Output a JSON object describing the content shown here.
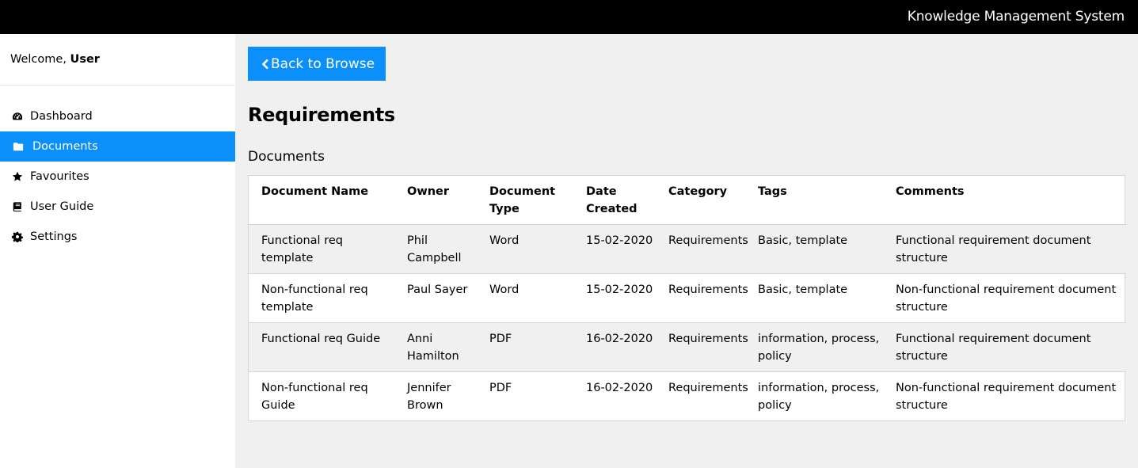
{
  "app": {
    "title": "Knowledge Management System"
  },
  "sidebar": {
    "welcome_prefix": "Welcome,",
    "user_name": "User",
    "items": [
      {
        "label": "Dashboard",
        "icon": "dashboard-icon",
        "active": false
      },
      {
        "label": "Documents",
        "icon": "folder-icon",
        "active": true
      },
      {
        "label": "Favourites",
        "icon": "star-icon",
        "active": false
      },
      {
        "label": "User Guide",
        "icon": "book-icon",
        "active": false
      },
      {
        "label": "Settings",
        "icon": "gear-icon",
        "active": false
      }
    ]
  },
  "main": {
    "back_label": "Back to Browse",
    "title": "Requirements",
    "section": "Documents",
    "table": {
      "headers": [
        "Document Name",
        "Owner",
        "Document Type",
        "Date Created",
        "Category",
        "Tags",
        "Comments"
      ],
      "rows": [
        [
          "Functional req template",
          "Phil Campbell",
          "Word",
          "15-02-2020",
          "Requirements",
          "Basic, template",
          "Functional requirement document structure"
        ],
        [
          "Non-functional req template",
          "Paul Sayer",
          "Word",
          "15-02-2020",
          "Requirements",
          "Basic, template",
          "Non-functional requirement document structure"
        ],
        [
          "Functional req Guide",
          "Anni Hamilton",
          "PDF",
          "16-02-2020",
          "Requirements",
          "information, process, policy",
          "Functional requirement document structure"
        ],
        [
          "Non-functional req Guide",
          "Jennifer Brown",
          "PDF",
          "16-02-2020",
          "Requirements",
          "information, process, policy",
          "Non-functional requirement document structure"
        ]
      ]
    }
  },
  "colors": {
    "accent": "#0b8ffa",
    "topbar": "#000000",
    "content_bg": "#f0f0f0"
  }
}
